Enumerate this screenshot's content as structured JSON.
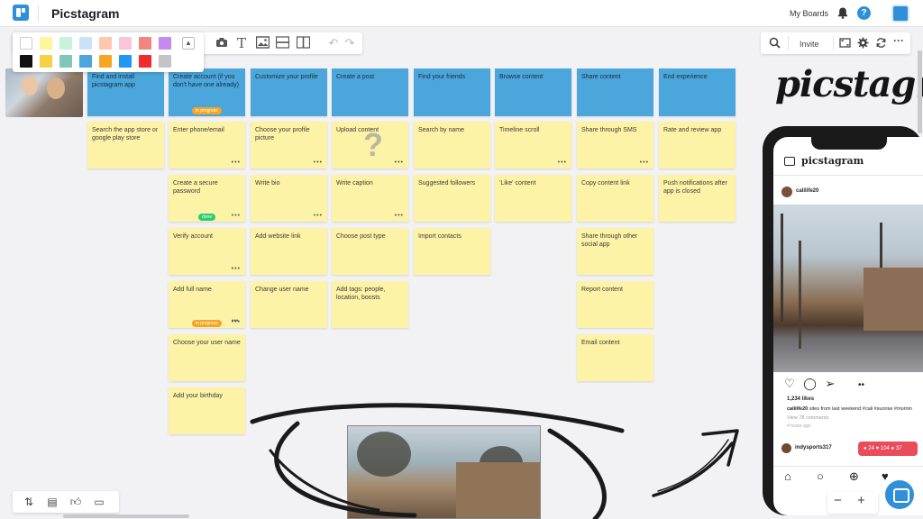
{
  "app": {
    "title": "Picstagram"
  },
  "header": {
    "my_boards": "My Boards",
    "help": "?"
  },
  "right_toolbar": {
    "invite": "Invite"
  },
  "colors": {
    "accent": "#2f8fd8",
    "note_blue": "#4aa6db",
    "note_yellow": "#fdf3a6",
    "badge_orange": "#f5a623",
    "badge_green": "#2ecc71",
    "notif_red": "#e94d5c"
  },
  "swatches": {
    "row1": [
      "#ffffff",
      "#fff59d",
      "#c8f2dc",
      "#c9e3f5",
      "#ffc7ae",
      "#f9c6d9",
      "#f2857f",
      "#c38bf0"
    ],
    "row2": [
      "#111111",
      "#f7d046",
      "#80c7b9",
      "#4aa6db",
      "#f5a623",
      "#2196f3",
      "#ef2b2b",
      "#c4c4c4"
    ]
  },
  "tools": [
    "camera-icon",
    "text-icon",
    "image-icon",
    "horizontal-line-icon",
    "vertical-line-icon",
    "undo-icon",
    "redo-icon"
  ],
  "columns": [
    {
      "header": "Find and install picstagram app",
      "notes": [
        {
          "text": "Search the app store or google play store"
        }
      ]
    },
    {
      "header": "Create account (if you don't have one already)",
      "header_badge": "in progress",
      "notes": [
        {
          "text": "Enter phone/email"
        },
        {
          "text": "Create a secure password",
          "badge": "done"
        },
        {
          "text": "Verify account"
        },
        {
          "text": "Add full name",
          "badge": "in progress"
        },
        {
          "text": "Choose your user name"
        },
        {
          "text": "Add your birthday"
        }
      ]
    },
    {
      "header": "Customize your profile",
      "notes": [
        {
          "text": "Choose your profile picture"
        },
        {
          "text": "Write bio"
        },
        {
          "text": "Add website link"
        },
        {
          "text": "Change user name"
        }
      ]
    },
    {
      "header": "Create a post",
      "notes": [
        {
          "text": "Upload content"
        },
        {
          "text": "Write caption"
        },
        {
          "text": "Choose post type"
        },
        {
          "text": "Add tags: people, location, boosts"
        }
      ]
    },
    {
      "header": "Find your friends",
      "notes": [
        {
          "text": "Search by name"
        },
        {
          "text": "Suggested followers"
        },
        {
          "text": "Import contacts"
        }
      ]
    },
    {
      "header": "Browse content",
      "notes": [
        {
          "text": "Timeline scroll"
        },
        {
          "text": "'Like' content"
        }
      ]
    },
    {
      "header": "Share content",
      "notes": [
        {
          "text": "Share through SMS"
        },
        {
          "text": "Copy content link"
        },
        {
          "text": "Share through other social app"
        },
        {
          "text": "Report content"
        },
        {
          "text": "Email content"
        }
      ]
    },
    {
      "header": "End experience",
      "notes": [
        {
          "text": "Rate and review app"
        },
        {
          "text": "Push notifications after app is closed"
        }
      ]
    }
  ],
  "note_question_mark": "?",
  "brand_text": "picstagra",
  "phone": {
    "logo": "picstagram",
    "user": "calilife20",
    "likes": "1,234 likes",
    "caption_user": "calilife20",
    "caption_text": " sites from last weekend #cali #sunrise #mornin",
    "comments": "View 78 comments",
    "time": "4 hours ago",
    "user2": "indysports317",
    "notif": "● 24  ♥ 104  ● 37"
  },
  "zoom": {
    "minus": "−",
    "plus": "+"
  }
}
